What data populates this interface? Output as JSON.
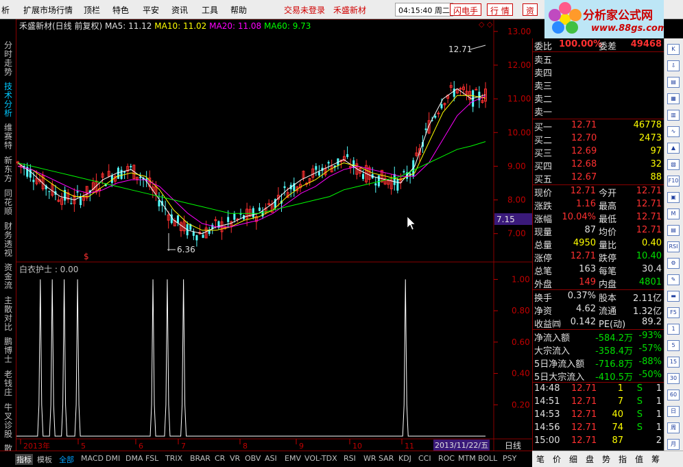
{
  "menu": [
    "析",
    "扩展市场行情",
    "顶栏",
    "特色",
    "平安",
    "资讯",
    "工具",
    "帮助"
  ],
  "menu_red": [
    "交易未登录",
    "禾盛新材"
  ],
  "clock": "04:15:40 周二",
  "top_buttons": [
    "闪电手",
    "行 情",
    "资"
  ],
  "logo": {
    "title": "分析家公式网",
    "url": "www.88gs.com"
  },
  "left_tabs": [
    "分时走势",
    "技术分析",
    "维赛特",
    "新东方",
    "同花顺",
    "财务透视",
    "资金流",
    "主散对比",
    "鹏博士",
    "老钱庄",
    "牛叉诊股",
    "散死"
  ],
  "chart_title": {
    "name": "禾盛新材(日线 前复权)",
    "ma5": "MA5: 11.12",
    "ma10": "MA10: 11.02",
    "ma20": "MA20: 11.08",
    "ma60": "MA60: 9.73",
    "corner": "◇ ◇"
  },
  "indicator_title": "白衣护士 : 0.00",
  "chart_data": [
    {
      "type": "candlestick",
      "title": "禾盛新材(日线 前复权)",
      "y_ticks": [
        7.0,
        8.0,
        9.0,
        10.0,
        11.0,
        12.0,
        13.0
      ],
      "ylim": [
        6.2,
        13.2
      ],
      "x_ticks": [
        "2013年",
        "5",
        "6",
        "7",
        "8",
        "9",
        "10",
        "11",
        "2013/11/22/五"
      ],
      "annotations": {
        "high": "12.71",
        "low": "6.36",
        "current": "7.15",
        "marker": "$"
      },
      "series": [
        {
          "name": "MA5",
          "color": "#ffffff",
          "values": [
            9.1,
            8.8,
            8.4,
            8.1,
            8.0,
            8.2,
            8.6,
            8.8,
            8.9,
            8.6,
            8.0,
            7.4,
            7.1,
            7.0,
            7.2,
            7.3,
            7.5,
            7.6,
            7.9,
            8.3,
            8.6,
            8.8,
            9.0,
            9.2,
            8.9,
            8.7,
            8.6,
            8.5,
            9.0,
            10.2,
            11.0,
            11.3,
            11.0,
            11.12
          ]
        },
        {
          "name": "MA10",
          "color": "#ffff00",
          "values": [
            9.0,
            8.9,
            8.6,
            8.3,
            8.1,
            8.1,
            8.4,
            8.7,
            8.8,
            8.7,
            8.3,
            7.7,
            7.3,
            7.1,
            7.1,
            7.2,
            7.4,
            7.5,
            7.7,
            8.1,
            8.4,
            8.6,
            8.9,
            9.1,
            9.0,
            8.8,
            8.7,
            8.6,
            8.8,
            9.7,
            10.6,
            11.1,
            11.1,
            11.02
          ]
        },
        {
          "name": "MA20",
          "color": "#ff00ff",
          "values": [
            9.0,
            8.9,
            8.7,
            8.5,
            8.3,
            8.2,
            8.3,
            8.5,
            8.6,
            8.6,
            8.4,
            8.0,
            7.6,
            7.3,
            7.2,
            7.2,
            7.3,
            7.4,
            7.6,
            7.9,
            8.2,
            8.4,
            8.7,
            8.9,
            9.0,
            8.9,
            8.8,
            8.7,
            8.7,
            9.1,
            9.8,
            10.5,
            10.9,
            11.08
          ]
        },
        {
          "name": "MA60",
          "color": "#00ff00",
          "values": [
            9.1,
            9.0,
            8.9,
            8.8,
            8.7,
            8.6,
            8.5,
            8.4,
            8.3,
            8.2,
            8.1,
            8.0,
            7.9,
            7.8,
            7.7,
            7.6,
            7.6,
            7.6,
            7.7,
            7.8,
            7.9,
            8.0,
            8.1,
            8.3,
            8.4,
            8.5,
            8.6,
            8.7,
            8.9,
            9.1,
            9.3,
            9.5,
            9.6,
            9.73
          ]
        }
      ]
    },
    {
      "type": "line",
      "title": "白衣护士 : 0.00",
      "y_ticks": [
        0.2,
        0.4,
        0.6,
        0.8,
        1.0
      ],
      "ylim": [
        0,
        1.05
      ],
      "spikes_x": [
        0.05,
        0.075,
        0.1,
        0.128,
        0.286,
        0.316,
        0.35,
        0.815
      ]
    }
  ],
  "period_label": "日线",
  "quote": {
    "weibi": {
      "label": "委比",
      "value": "100.00%",
      "label2": "委差",
      "value2": "49468"
    },
    "sells": [
      {
        "label": "卖五",
        "price": "",
        "vol": ""
      },
      {
        "label": "卖四",
        "price": "",
        "vol": ""
      },
      {
        "label": "卖三",
        "price": "",
        "vol": ""
      },
      {
        "label": "卖二",
        "price": "",
        "vol": ""
      },
      {
        "label": "卖一",
        "price": "",
        "vol": ""
      }
    ],
    "buys": [
      {
        "label": "买一",
        "price": "12.71",
        "vol": "46778"
      },
      {
        "label": "买二",
        "price": "12.70",
        "vol": "2473"
      },
      {
        "label": "买三",
        "price": "12.69",
        "vol": "97"
      },
      {
        "label": "买四",
        "price": "12.68",
        "vol": "32"
      },
      {
        "label": "买五",
        "price": "12.67",
        "vol": "88"
      }
    ],
    "stats1": [
      {
        "l1": "现价",
        "v1": "12.71",
        "c1": "r",
        "l2": "今开",
        "v2": "12.71",
        "c2": "r"
      },
      {
        "l1": "涨跌",
        "v1": "1.16",
        "c1": "r",
        "l2": "最高",
        "v2": "12.71",
        "c2": "r"
      },
      {
        "l1": "涨幅",
        "v1": "10.04%",
        "c1": "r",
        "l2": "最低",
        "v2": "12.71",
        "c2": "r"
      },
      {
        "l1": "现量",
        "v1": "87",
        "c1": "w",
        "l2": "均价",
        "v2": "12.71",
        "c2": "r"
      },
      {
        "l1": "总量",
        "v1": "4950",
        "c1": "y",
        "l2": "量比",
        "v2": "0.40",
        "c2": "y"
      },
      {
        "l1": "涨停",
        "v1": "12.71",
        "c1": "r",
        "l2": "跌停",
        "v2": "10.40",
        "c2": "g"
      },
      {
        "l1": "总笔",
        "v1": "163",
        "c1": "w",
        "l2": "每笔",
        "v2": "30.4",
        "c2": "w"
      },
      {
        "l1": "外盘",
        "v1": "149",
        "c1": "r",
        "l2": "内盘",
        "v2": "4801",
        "c2": "g"
      }
    ],
    "stats2": [
      {
        "l1": "换手",
        "v1": "0.37%",
        "c1": "w",
        "l2": "股本",
        "v2": "2.11亿",
        "c2": "w"
      },
      {
        "l1": "净资",
        "v1": "4.62",
        "c1": "w",
        "l2": "流通",
        "v2": "1.32亿",
        "c2": "w"
      },
      {
        "l1": "收益㈣",
        "v1": "0.142",
        "c1": "w",
        "l2": "PE(动)",
        "v2": "89.2",
        "c2": "w"
      }
    ],
    "flows": [
      {
        "label": "净流入额",
        "value": "-584.2万",
        "pct": "-93%"
      },
      {
        "label": "大宗流入",
        "value": "-358.4万",
        "pct": "-57%"
      },
      {
        "label": "5日净流入额",
        "value": "-716.8万",
        "pct": "-88%"
      },
      {
        "label": "5日大宗流入",
        "value": "-410.5万",
        "pct": "-50%"
      }
    ],
    "ticks": [
      {
        "time": "14:48",
        "price": "12.71",
        "vol": "1",
        "side": "S",
        "n": "1"
      },
      {
        "time": "14:51",
        "price": "12.71",
        "vol": "7",
        "side": "S",
        "n": "1"
      },
      {
        "time": "14:53",
        "price": "12.71",
        "vol": "40",
        "side": "S",
        "n": "1"
      },
      {
        "time": "14:56",
        "price": "12.71",
        "vol": "74",
        "side": "S",
        "n": "1"
      },
      {
        "time": "15:00",
        "price": "12.71",
        "vol": "87",
        "side": "",
        "n": "2"
      }
    ]
  },
  "bottom_tabs": [
    "指标",
    "模板",
    "全部",
    "MACD",
    "DMI",
    "DMA",
    "FSL",
    "TRIX",
    "BRAR",
    "CR",
    "VR",
    "OBV",
    "ASI",
    "EMV",
    "VOL-TDX",
    "RSI",
    "WR",
    "SAR",
    "KDJ",
    "CCI",
    "ROC",
    "MTM",
    "BOLL",
    "PSY"
  ],
  "right_bottom_tabs": [
    "笔",
    "价",
    "细",
    "盘",
    "势",
    "指",
    "值",
    "筹"
  ],
  "icon_column": [
    "K",
    "⇩",
    "▤",
    "▦",
    "▥",
    "∿",
    "▲",
    "▧",
    "F10",
    "▣",
    "M",
    "▤",
    "RSI",
    "⚙",
    "✎",
    "▬",
    "F5",
    "1",
    "5",
    "15",
    "30",
    "60",
    "日",
    "周",
    "月"
  ]
}
